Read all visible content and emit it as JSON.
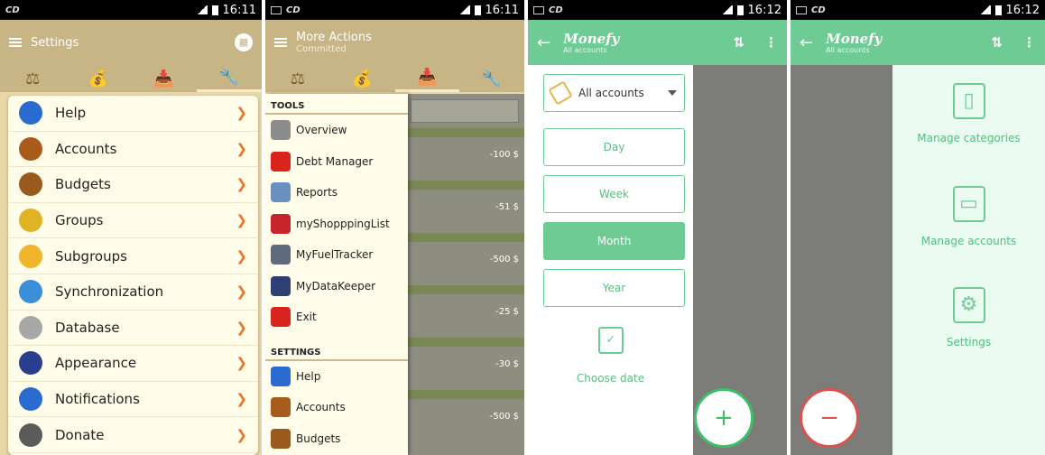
{
  "status_bar": {
    "carrier": "CD",
    "phone1_time": "16:11",
    "phone2_time": "16:11",
    "phone3_time": "16:12",
    "phone4_time": "16:12"
  },
  "phone1": {
    "toolbar_title": "Settings",
    "menu": [
      {
        "label": "Help",
        "icon": "help-icon",
        "color": "#2a6bd0"
      },
      {
        "label": "Accounts",
        "icon": "wallet-icon",
        "color": "#a85b1a"
      },
      {
        "label": "Budgets",
        "icon": "money-bag-icon",
        "color": "#9a5a1c"
      },
      {
        "label": "Groups",
        "icon": "coins-stack-icon",
        "color": "#e0b324"
      },
      {
        "label": "Subgroups",
        "icon": "coin-icon",
        "color": "#f0b52b"
      },
      {
        "label": "Synchronization",
        "icon": "cloud-sync-icon",
        "color": "#3b8ed8"
      },
      {
        "label": "Database",
        "icon": "database-icon",
        "color": "#a7a7a7"
      },
      {
        "label": "Appearance",
        "icon": "palette-icon",
        "color": "#2a3e8e"
      },
      {
        "label": "Notifications",
        "icon": "alert-icon",
        "color": "#2a6bd0"
      },
      {
        "label": "Donate",
        "icon": "donate-icon",
        "color": "#5b5b5b"
      }
    ]
  },
  "phone2": {
    "toolbar_title": "More Actions",
    "toolbar_subtitle": "Committed",
    "tools_header": "TOOLS",
    "tools": [
      {
        "label": "Overview",
        "icon": "clipboard-icon",
        "color": "#8c8c8c"
      },
      {
        "label": "Debt Manager",
        "icon": "percent-icon",
        "color": "#d9231d"
      },
      {
        "label": "Reports",
        "icon": "magnifier-icon",
        "color": "#6b8fbf"
      },
      {
        "label": "myShopppingList",
        "icon": "basket-icon",
        "color": "#c8242b"
      },
      {
        "label": "MyFuelTracker",
        "icon": "car-icon",
        "color": "#5f6a7a"
      },
      {
        "label": "MyDataKeeper",
        "icon": "shield-icon",
        "color": "#2f3f73"
      },
      {
        "label": "Exit",
        "icon": "power-icon",
        "color": "#d9231d"
      }
    ],
    "settings_header": "SETTINGS",
    "settings": [
      {
        "label": "Help",
        "icon": "help-icon",
        "color": "#2a6bd0"
      },
      {
        "label": "Accounts",
        "icon": "wallet-icon",
        "color": "#a85b1a"
      },
      {
        "label": "Budgets",
        "icon": "money-bag-icon",
        "color": "#9a5a1c"
      }
    ],
    "amounts": [
      "-100 $",
      "-51 $",
      "-500 $",
      "-25 $",
      "-30 $",
      "-500 $"
    ]
  },
  "phone3": {
    "brand": "Monefy",
    "subtitle": "All accounts",
    "account_select": "All accounts",
    "periods": [
      "Day",
      "Week",
      "Month",
      "Year"
    ],
    "selected_period": "Month",
    "choose_date": "Choose date"
  },
  "phone4": {
    "brand": "Monefy",
    "subtitle": "All accounts",
    "actions": [
      {
        "label": "Manage categories",
        "icon": "notebook-icon"
      },
      {
        "label": "Manage accounts",
        "icon": "wallet-icon"
      },
      {
        "label": "Settings",
        "icon": "gear-icon"
      }
    ]
  },
  "colors": {
    "beige": "#c7b585",
    "green": "#6fcb94",
    "chevron": "#e8772b"
  }
}
